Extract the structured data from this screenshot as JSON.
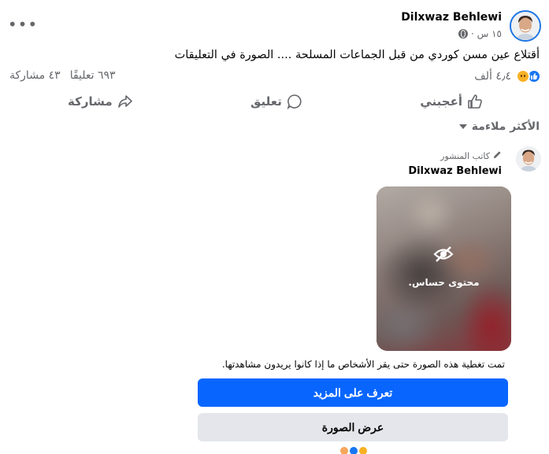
{
  "post": {
    "author": "Dilxwaz Behlewi",
    "time": "١٥ س ·",
    "text": "أقتلاع عين مسن كوردي من قبل الجماعات المسلحة .... الصورة في التعليقات",
    "reactions_count": "٤٫٤ ألف",
    "comments_count": "٦٩٣ تعليقًا",
    "shares_count": "٤٣ مشاركة"
  },
  "actions": {
    "like": "أعجبني",
    "comment": "تعليق",
    "share": "مشاركة"
  },
  "sort": {
    "label": "الأكثر ملاءمة"
  },
  "comment": {
    "badge": "كاتب المنشور",
    "author": "Dilxwaz Behlewi",
    "sensitive_label": "محتوى حساس.",
    "cover_text": "تمت تغطية هذه الصورة حتى يقر الأشخاص ما إذا كانوا يريدون مشاهدتها.",
    "learn_more": "تعرف على المزيد",
    "view_photo": "عرض الصورة"
  },
  "colors": {
    "primary": "#0866ff",
    "secondary_text": "#65676b",
    "button_gray": "#e4e6eb"
  },
  "icons": [
    "more-icon",
    "globe-icon",
    "like-reaction-icon",
    "sad-reaction-icon",
    "thumbs-up-icon",
    "comment-icon",
    "share-icon",
    "caret-down-icon",
    "pencil-icon",
    "eye-slash-icon"
  ]
}
